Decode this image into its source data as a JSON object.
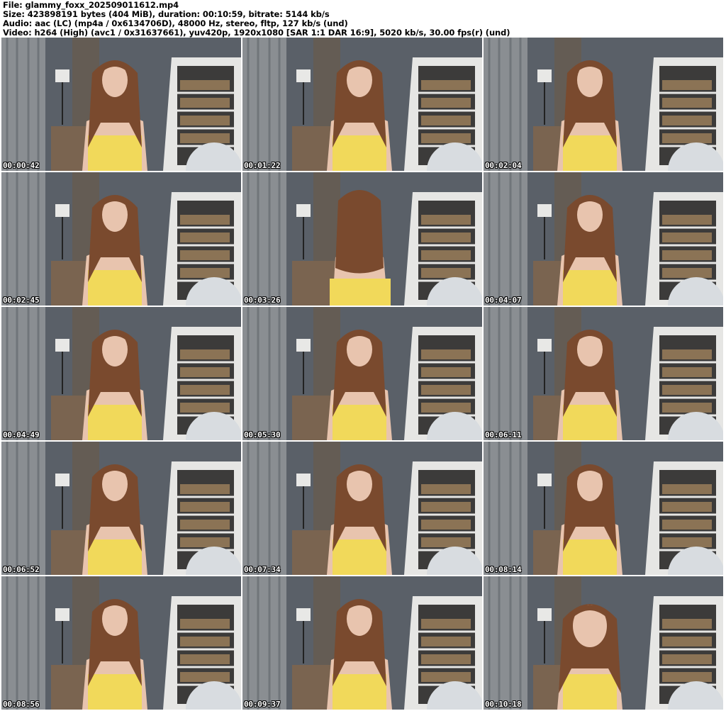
{
  "header": {
    "file_line": "File: glammy_foxx_202509011612.mp4",
    "size_line": "Size: 423898191 bytes (404 MiB), duration: 00:10:59, bitrate: 5144 kb/s",
    "audio_line": "Audio: aac (LC) (mp4a / 0x6134706D), 48000 Hz, stereo, fltp, 127 kb/s (und)",
    "video_line": "Video: h264 (High) (avc1 / 0x31637661), yuv420p, 1920x1080 [SAR 1:1 DAR 16:9], 5020 kb/s, 30.00 fps(r) (und)"
  },
  "colors": {
    "wall": "#5a6068",
    "curtain": "#8a8e92",
    "shelf": "#e6e6e4",
    "dress": "#f1d95a",
    "hair": "#7a4a2e",
    "skin": "#e8c4ae"
  },
  "thumbnails": [
    {
      "timestamp": "00:00:42",
      "pose": "front"
    },
    {
      "timestamp": "00:01:22",
      "pose": "front"
    },
    {
      "timestamp": "00:02:04",
      "pose": "front"
    },
    {
      "timestamp": "00:02:45",
      "pose": "side"
    },
    {
      "timestamp": "00:03:26",
      "pose": "back"
    },
    {
      "timestamp": "00:04:07",
      "pose": "front"
    },
    {
      "timestamp": "00:04:49",
      "pose": "side"
    },
    {
      "timestamp": "00:05:30",
      "pose": "front"
    },
    {
      "timestamp": "00:06:11",
      "pose": "front"
    },
    {
      "timestamp": "00:06:52",
      "pose": "side"
    },
    {
      "timestamp": "00:07:34",
      "pose": "front"
    },
    {
      "timestamp": "00:08:14",
      "pose": "side"
    },
    {
      "timestamp": "00:08:56",
      "pose": "side"
    },
    {
      "timestamp": "00:09:37",
      "pose": "front"
    },
    {
      "timestamp": "00:10:18",
      "pose": "close"
    }
  ]
}
